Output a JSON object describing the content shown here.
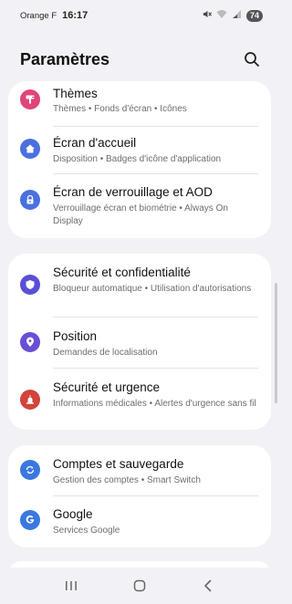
{
  "status_bar": {
    "carrier": "Orange F",
    "time": "16:17",
    "battery": "74"
  },
  "header": {
    "title": "Paramètres"
  },
  "colors": {
    "themes": "#e0457a",
    "home_screen": "#4a70e0",
    "lock_screen": "#4a70e0",
    "security_privacy": "#5a4fd6",
    "location": "#6a4fd6",
    "safety_emergency": "#d2443c",
    "accounts_backup": "#3a78e0",
    "google": "#3a78e0"
  },
  "groups": [
    {
      "items": [
        {
          "title": "Thèmes",
          "subtitle": "Thèmes  •  Fonds d'écran  •  Icônes",
          "icon": "brush-icon"
        },
        {
          "title": "Écran d'accueil",
          "subtitle": "Disposition  •  Badges d'icône d'application",
          "icon": "home-icon"
        },
        {
          "title": "Écran de verrouillage et AOD",
          "subtitle": "Verrouillage écran et biométrie  •  Always On Display",
          "icon": "lock-icon"
        }
      ]
    },
    {
      "items": [
        {
          "title": "Sécurité et confidentialité",
          "subtitle": "Bloqueur automatique  •  Utilisation d'autorisations",
          "icon": "shield-icon"
        },
        {
          "title": "Position",
          "subtitle": "Demandes de localisation",
          "icon": "location-pin-icon"
        },
        {
          "title": "Sécurité et urgence",
          "subtitle": "Informations médicales  •  Alertes d'urgence sans fil",
          "icon": "emergency-icon"
        }
      ]
    },
    {
      "items": [
        {
          "title": "Comptes et sauvegarde",
          "subtitle": "Gestion des comptes  •  Smart Switch",
          "icon": "sync-icon"
        },
        {
          "title": "Google",
          "subtitle": "Services Google",
          "icon": "google-icon"
        }
      ]
    }
  ]
}
